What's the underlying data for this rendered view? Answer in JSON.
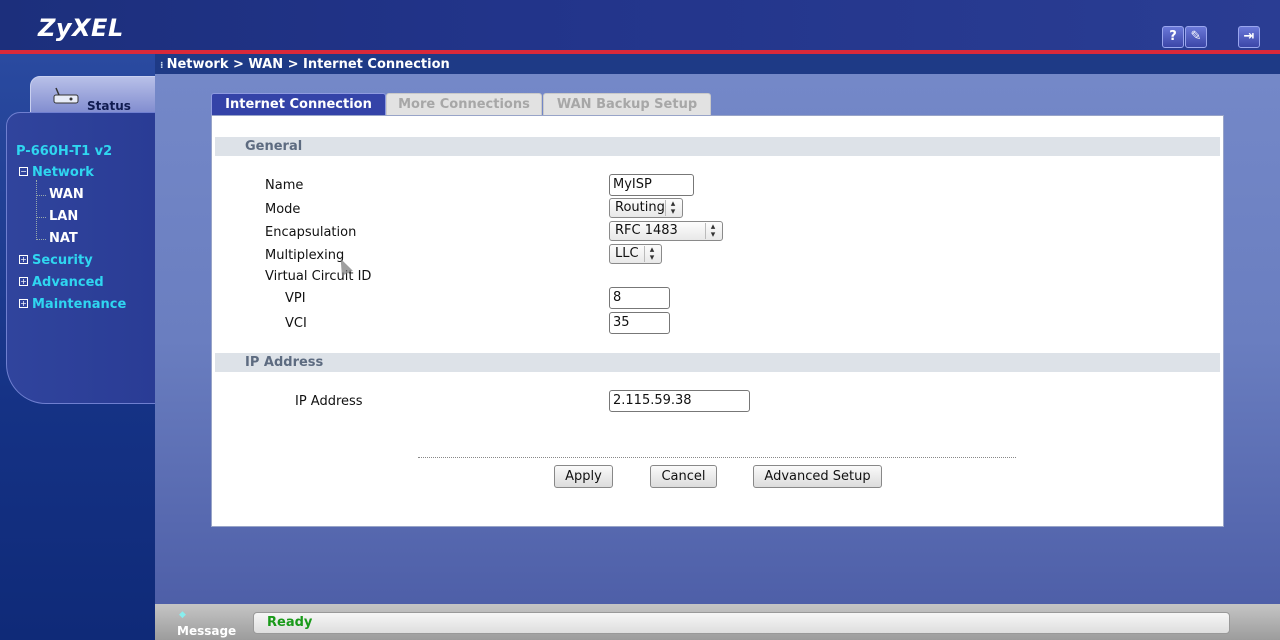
{
  "brand": {
    "logo": "ZyXEL"
  },
  "top_icons": [
    {
      "name": "help-icon",
      "glyph": "?"
    },
    {
      "name": "wizard-icon",
      "glyph": "✎"
    },
    {
      "name": "logout-icon",
      "glyph": "⇥"
    }
  ],
  "breadcrumb": "Network > WAN > Internet Connection",
  "sidebar": {
    "status_tab": "Status",
    "model": "P-660H-T1 v2",
    "items": [
      {
        "label": "Network",
        "expanded": true,
        "children": [
          "WAN",
          "LAN",
          "NAT"
        ]
      },
      {
        "label": "Security",
        "expanded": false
      },
      {
        "label": "Advanced",
        "expanded": false
      },
      {
        "label": "Maintenance",
        "expanded": false
      }
    ]
  },
  "tabs": [
    {
      "label": "Internet Connection",
      "active": true
    },
    {
      "label": "More Connections",
      "active": false
    },
    {
      "label": "WAN Backup Setup",
      "active": false
    }
  ],
  "sections": {
    "general": "General",
    "ip": "IP Address"
  },
  "form": {
    "name": {
      "label": "Name",
      "value": "MyISP"
    },
    "mode": {
      "label": "Mode",
      "value": "Routing"
    },
    "encapsulation": {
      "label": "Encapsulation",
      "value": "RFC 1483"
    },
    "multiplexing": {
      "label": "Multiplexing",
      "value": "LLC"
    },
    "vcid": {
      "label": "Virtual Circuit ID"
    },
    "vpi": {
      "label": "VPI",
      "value": "8"
    },
    "vci": {
      "label": "VCI",
      "value": "35"
    },
    "ip_address": {
      "label": "IP Address",
      "value": "2.115.59.38"
    }
  },
  "buttons": {
    "apply": "Apply",
    "cancel": "Cancel",
    "advanced": "Advanced Setup"
  },
  "message": {
    "label": "Message",
    "text": "Ready"
  }
}
